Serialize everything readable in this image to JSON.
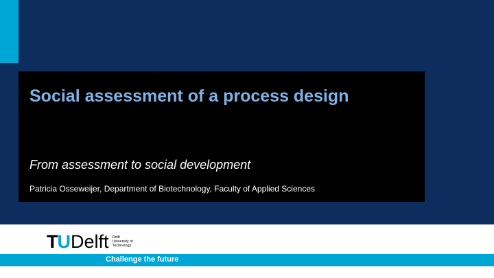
{
  "slide": {
    "title": "Social assessment of a process design",
    "subtitle": "From assessment to social development",
    "author": "Patricia Osseweijer, Department of Biotechnology, Faculty of Applied Sciences"
  },
  "logo": {
    "tu_t": "T",
    "tu_u": "U",
    "delft": "Delft",
    "sub_line1": "Delft",
    "sub_line2": "University of",
    "sub_line3": "Technology"
  },
  "footer": {
    "tagline": "Challenge the future"
  },
  "colors": {
    "background": "#0c2d5e",
    "accent": "#00a6d6",
    "title": "#7fb2e5",
    "title_box": "#000000"
  }
}
